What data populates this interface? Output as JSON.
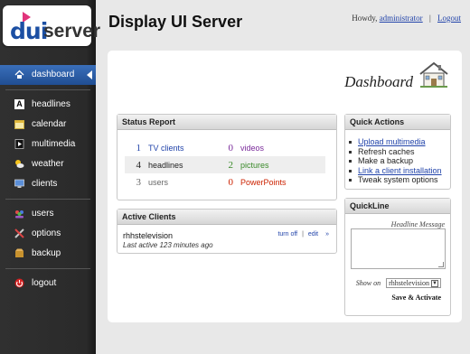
{
  "logo": {
    "part1": "dui",
    "part2": "server"
  },
  "header": {
    "title": "Display UI Server",
    "greeting": "Howdy,",
    "user": "administrator",
    "separator": "|",
    "logout": "Logout"
  },
  "sidebar": {
    "items": [
      {
        "label": "dashboard",
        "icon": "house-icon",
        "active": true
      },
      {
        "label": "headlines",
        "icon": "letter-a-icon"
      },
      {
        "label": "calendar",
        "icon": "calendar-icon"
      },
      {
        "label": "multimedia",
        "icon": "film-icon"
      },
      {
        "label": "weather",
        "icon": "sun-cloud-icon"
      },
      {
        "label": "clients",
        "icon": "monitor-icon"
      },
      {
        "label": "users",
        "icon": "users-icon"
      },
      {
        "label": "options",
        "icon": "tools-icon"
      },
      {
        "label": "backup",
        "icon": "box-icon"
      },
      {
        "label": "logout",
        "icon": "power-icon"
      }
    ]
  },
  "page_title": "Dashboard",
  "status_report": {
    "title": "Status Report",
    "rows": [
      {
        "n1": "1",
        "l1": "TV clients",
        "n2": "0",
        "l2": "videos"
      },
      {
        "n1": "4",
        "l1": "headlines",
        "n2": "2",
        "l2": "pictures"
      },
      {
        "n1": "3",
        "l1": "users",
        "n2": "0",
        "l2": "PowerPoints"
      }
    ]
  },
  "active_clients": {
    "title": "Active Clients",
    "client": "rhhstelevision",
    "last_active": "Last active 123 minutes ago",
    "turn_off": "turn off",
    "sep": "|",
    "edit": "edit",
    "more": "»"
  },
  "quick_actions": {
    "title": "Quick Actions",
    "items": [
      "Upload multimedia",
      "Refresh caches",
      "Make a backup",
      "Link a client installation",
      "Tweak system options"
    ]
  },
  "quickline": {
    "title": "QuickLine",
    "message_label": "Headline Message",
    "show_on": "Show on",
    "selected": "rhhstelevision",
    "button": "Save & Activate"
  },
  "colors": {
    "accent": "#2a5ea8",
    "link": "#2244aa",
    "green": "#3a8a2a",
    "purple": "#7a2a9a",
    "red": "#cc2200"
  }
}
